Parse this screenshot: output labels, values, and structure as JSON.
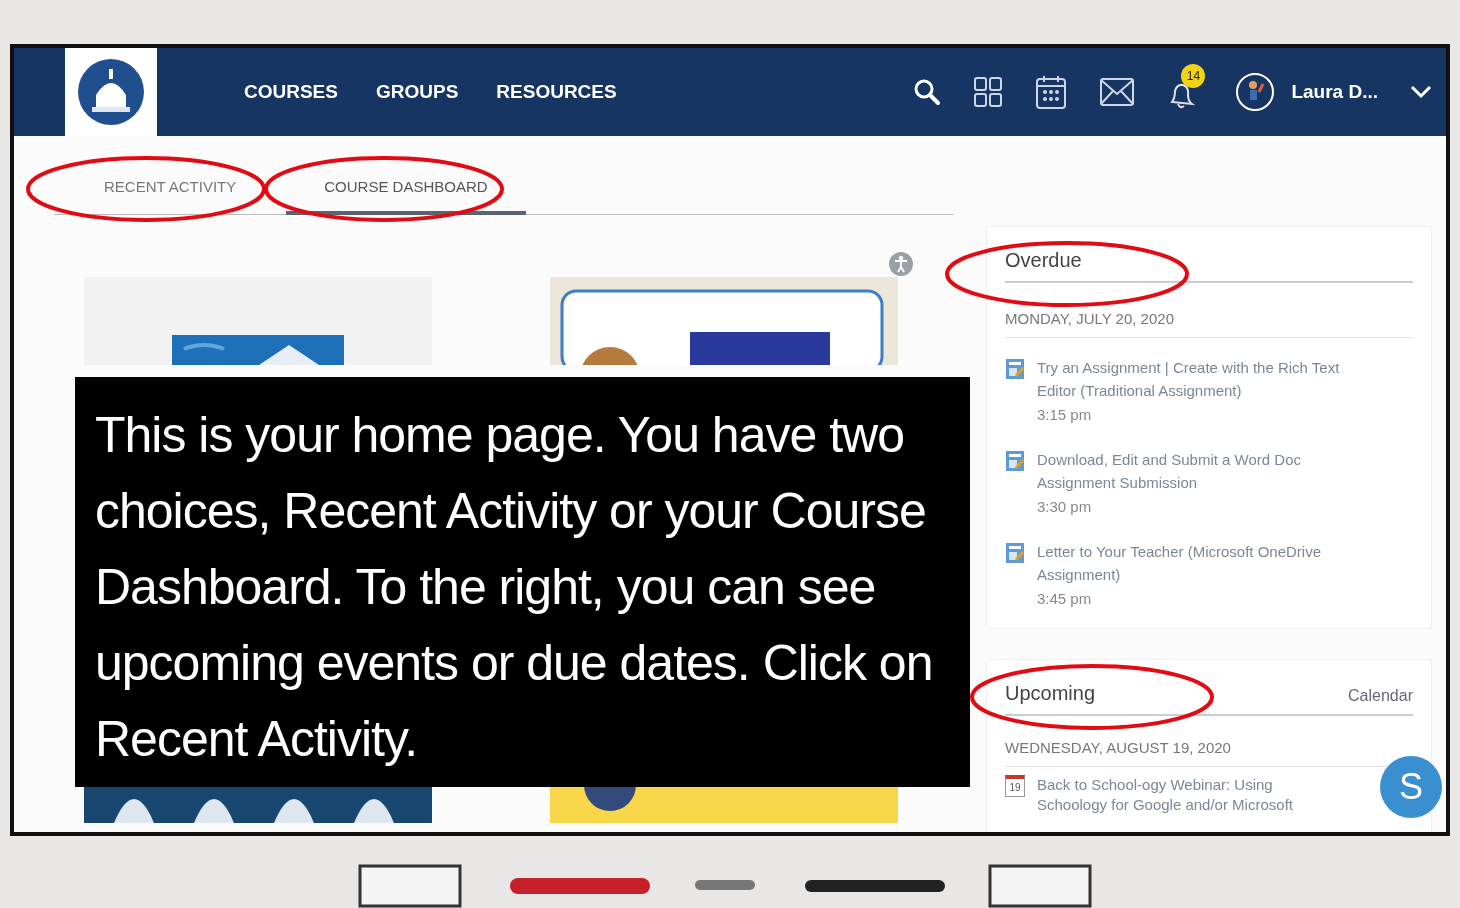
{
  "nav": {
    "links": [
      "COURSES",
      "GROUPS",
      "RESOURCES"
    ],
    "notification_count": "14",
    "user_name": "Laura D..."
  },
  "tabs": [
    {
      "label": "RECENT ACTIVITY",
      "selected": false
    },
    {
      "label": "COURSE DASHBOARD",
      "selected": true
    }
  ],
  "overdue": {
    "title": "Overdue",
    "date": "MONDAY, JULY 20, 2020",
    "items": [
      {
        "title": "Try an Assignment | Create with the Rich Text Editor (Traditional Assignment)",
        "time": "3:15 pm"
      },
      {
        "title": "Download, Edit and Submit a Word Doc Assignment Submission",
        "time": "3:30 pm"
      },
      {
        "title": "Letter to Your Teacher (Microsoft OneDrive Assignment)",
        "time": "3:45 pm"
      }
    ]
  },
  "upcoming": {
    "title": "Upcoming",
    "link": "Calendar",
    "date": "WEDNESDAY, AUGUST 19, 2020",
    "items": [
      {
        "title": "Back to School-ogy Webinar: Using Schoology for Google and/or Microsoft",
        "day": "19"
      }
    ]
  },
  "help_button": "S",
  "callout": "This is your home page. You have two choices, Recent Activity or your Course Dashboard. To the right, you can see upcoming events or due dates. Click on Recent Activity."
}
